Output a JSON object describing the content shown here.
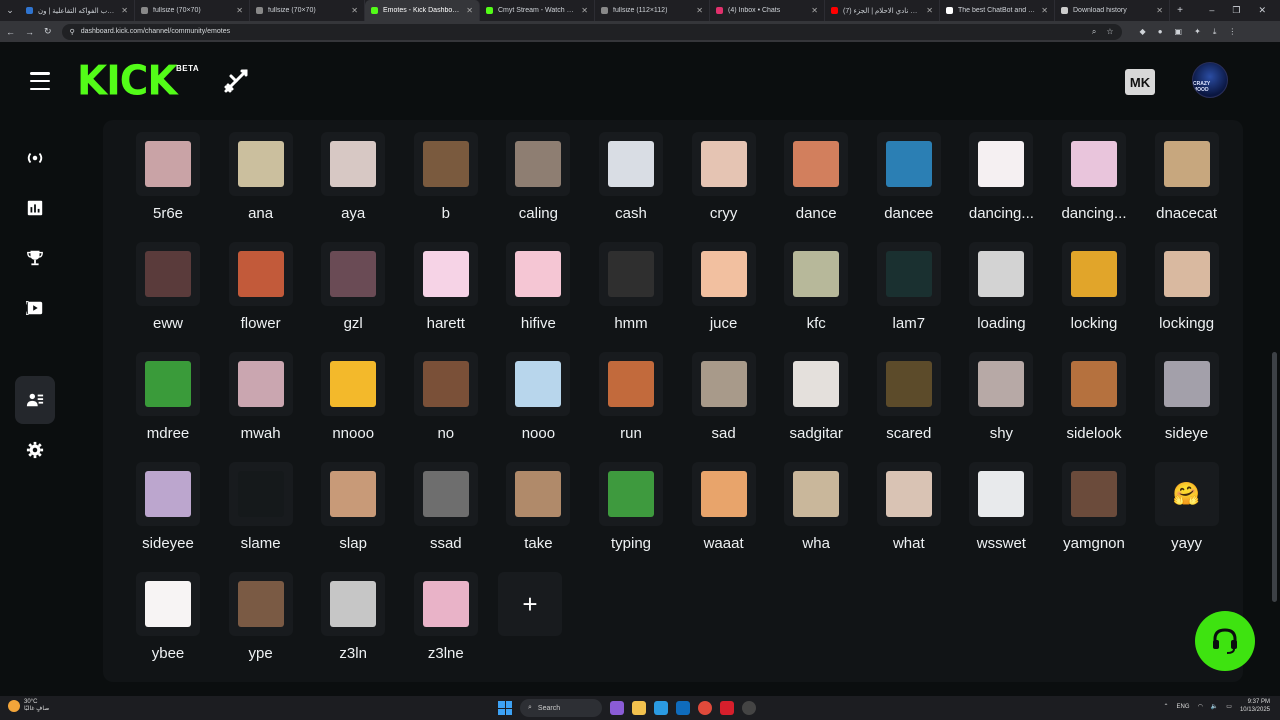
{
  "browser": {
    "tabs": [
      {
        "label": "لعبة حرب الفواكه التفاعلية | ون",
        "color": "#2f74d0"
      },
      {
        "label": "fullsize (70×70)",
        "color": "#888888"
      },
      {
        "label": "fullsize (70×70)",
        "color": "#888888"
      },
      {
        "label": "Emotes - Kick Dashboard",
        "color": "#53fc18",
        "active": true
      },
      {
        "label": "Cmyt Stream - Watch Live on",
        "color": "#53fc18"
      },
      {
        "label": "fullsize (112×112)",
        "color": "#888888"
      },
      {
        "label": "(4) Inbox • Chats",
        "color": "#e1306c"
      },
      {
        "label": "(7) سويت نادي الاحلام | الجزء",
        "color": "#ff0000"
      },
      {
        "label": "The best ChatBot and Widget",
        "color": "#ffffff"
      },
      {
        "label": "Download history",
        "color": "#cccccc"
      }
    ],
    "url": "dashboard.kick.com/channel/community/emotes"
  },
  "header": {
    "logo_text": "KICK",
    "beta_label": "BETA",
    "mk_label": "MK",
    "avatar_text": "CRAZY MOOD"
  },
  "sidebar": {
    "items": [
      {
        "name": "stream-icon"
      },
      {
        "name": "analytics-icon"
      },
      {
        "name": "trophy-icon"
      },
      {
        "name": "clips-icon"
      },
      {
        "name": "community-icon",
        "active": true
      },
      {
        "name": "settings-icon"
      }
    ]
  },
  "emotes": [
    {
      "name": "5r6e",
      "bg": "#c9a3a6",
      "glyph": ""
    },
    {
      "name": "ana",
      "bg": "#cbbf9e",
      "glyph": ""
    },
    {
      "name": "aya",
      "bg": "#d7c8c4",
      "glyph": ""
    },
    {
      "name": "b",
      "bg": "#7a5a3e",
      "glyph": ""
    },
    {
      "name": "caling",
      "bg": "#8e7e72",
      "glyph": ""
    },
    {
      "name": "cash",
      "bg": "#d9dde4",
      "glyph": ""
    },
    {
      "name": "cryy",
      "bg": "#e5c4b3",
      "glyph": ""
    },
    {
      "name": "dance",
      "bg": "#d27f5d",
      "glyph": ""
    },
    {
      "name": "dancee",
      "bg": "#2b7fb4",
      "glyph": ""
    },
    {
      "name": "dancing...",
      "bg": "#f5f0f2",
      "glyph": ""
    },
    {
      "name": "dancing...",
      "bg": "#e9c5dc",
      "glyph": ""
    },
    {
      "name": "dnacecat",
      "bg": "#c7a77e",
      "glyph": ""
    },
    {
      "name": "eww",
      "bg": "#5a3b3b",
      "glyph": ""
    },
    {
      "name": "flower",
      "bg": "#c25a3a",
      "glyph": ""
    },
    {
      "name": "gzl",
      "bg": "#6a4b55",
      "glyph": ""
    },
    {
      "name": "harett",
      "bg": "#f6d3e6",
      "glyph": ""
    },
    {
      "name": "hifive",
      "bg": "#f5c6d4",
      "glyph": ""
    },
    {
      "name": "hmm",
      "bg": "#2f2f2f",
      "glyph": ""
    },
    {
      "name": "juce",
      "bg": "#f2c0a0",
      "glyph": ""
    },
    {
      "name": "kfc",
      "bg": "#b7b89a",
      "glyph": ""
    },
    {
      "name": "lam7",
      "bg": "#1a3030",
      "glyph": ""
    },
    {
      "name": "loading",
      "bg": "#d3d3d3",
      "glyph": ""
    },
    {
      "name": "locking",
      "bg": "#e1a52a",
      "glyph": ""
    },
    {
      "name": "lockingg",
      "bg": "#d9b9a0",
      "glyph": ""
    },
    {
      "name": "mdree",
      "bg": "#3a9b3a",
      "glyph": ""
    },
    {
      "name": "mwah",
      "bg": "#caa6b0",
      "glyph": ""
    },
    {
      "name": "nnooo",
      "bg": "#f3b92b",
      "glyph": ""
    },
    {
      "name": "no",
      "bg": "#7a5038",
      "glyph": ""
    },
    {
      "name": "nooo",
      "bg": "#b8d6ec",
      "glyph": ""
    },
    {
      "name": "run",
      "bg": "#c26a3c",
      "glyph": ""
    },
    {
      "name": "sad",
      "bg": "#a89a8a",
      "glyph": ""
    },
    {
      "name": "sadgitar",
      "bg": "#e4e0dc",
      "glyph": ""
    },
    {
      "name": "scared",
      "bg": "#5c4b2a",
      "glyph": ""
    },
    {
      "name": "shy",
      "bg": "#b7a9a6",
      "glyph": ""
    },
    {
      "name": "sidelook",
      "bg": "#b5713e",
      "glyph": ""
    },
    {
      "name": "sideye",
      "bg": "#a3a0aa",
      "glyph": ""
    },
    {
      "name": "sideyee",
      "bg": "#bca6ce",
      "glyph": ""
    },
    {
      "name": "slame",
      "bg": "#15191b",
      "glyph": ""
    },
    {
      "name": "slap",
      "bg": "#c89a78",
      "glyph": ""
    },
    {
      "name": "ssad",
      "bg": "#6e6e6e",
      "glyph": ""
    },
    {
      "name": "take",
      "bg": "#b08a6a",
      "glyph": ""
    },
    {
      "name": "typing",
      "bg": "#3e9a3e",
      "glyph": ""
    },
    {
      "name": "waaat",
      "bg": "#e8a46b",
      "glyph": ""
    },
    {
      "name": "wha",
      "bg": "#c9b79b",
      "glyph": ""
    },
    {
      "name": "what",
      "bg": "#d9c3b4",
      "glyph": ""
    },
    {
      "name": "wsswet",
      "bg": "#e8eaec",
      "glyph": ""
    },
    {
      "name": "yamgnon",
      "bg": "#6b4b3b",
      "glyph": ""
    },
    {
      "name": "yayy",
      "bg": "#181b1e",
      "glyph": "🤗"
    },
    {
      "name": "ybee",
      "bg": "#f7f4f4",
      "glyph": ""
    },
    {
      "name": "ype",
      "bg": "#7a5a44",
      "glyph": ""
    },
    {
      "name": "z3ln",
      "bg": "#c6c6c6",
      "glyph": ""
    },
    {
      "name": "z3lne",
      "bg": "#e9b3c8",
      "glyph": ""
    }
  ],
  "add_emote_label": "+",
  "taskbar": {
    "weather_temp": "30°C",
    "weather_desc": "صافٍ غالبًا",
    "search_placeholder": "Search",
    "lang": "ENG",
    "time": "9:37 PM",
    "date": "10/13/2025"
  }
}
